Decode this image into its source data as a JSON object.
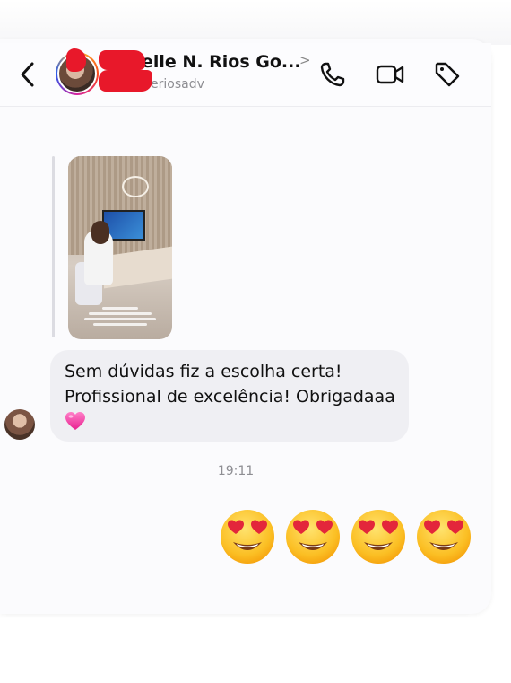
{
  "header": {
    "contact_name": "elle N. Rios Go...",
    "name_chevron": ">",
    "contact_handle": "eriosadv",
    "back_icon": "chevron-left-icon",
    "call_icon": "phone-icon",
    "video_icon": "video-camera-icon",
    "tag_icon": "tag-icon"
  },
  "thread": {
    "message": {
      "line1": "Sem dúvidas fiz a escolha certa!",
      "line2": "Profissional de excelência! Obrigadaaa",
      "emoji": "pink-heart"
    },
    "timestamp": "19:11",
    "reply_emojis": [
      "heart-eyes",
      "heart-eyes",
      "heart-eyes",
      "heart-eyes"
    ]
  },
  "colors": {
    "redaction": "#e8182a",
    "bubble": "#efeff3",
    "heart": "#f23fa1"
  }
}
